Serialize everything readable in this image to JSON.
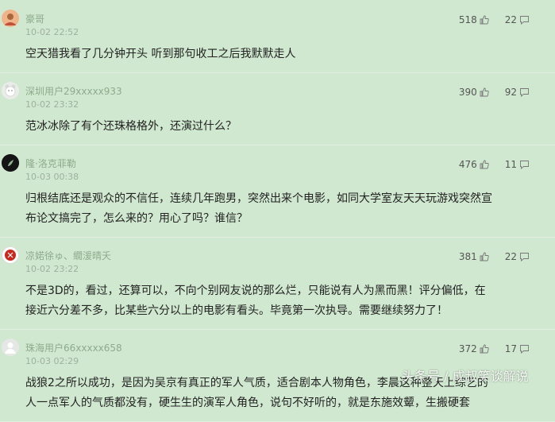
{
  "comments": [
    {
      "username": "豪哥",
      "time": "10-02 22:52",
      "likes": "518",
      "replies": "22",
      "text": "空天猎我看了几分钟开头 听到那句收工之后我默默走人"
    },
    {
      "username": "深圳用户29xxxxx933",
      "time": "10-02 23:32",
      "likes": "390",
      "replies": "92",
      "text": "范冰冰除了有个还珠格格外，还演过什么？"
    },
    {
      "username": "隆·洛克菲勒",
      "time": "10-03 00:38",
      "likes": "476",
      "replies": "11",
      "text": "归根结底还是观众的不信任，连续几年跑男，突然出来个电影，如同大学室友天天玩游戏突然宣\n布论文搞完了，怎么来的？用心了吗？谁信？"
    },
    {
      "username": "凉婼徐ゅ、繝湲晴夭",
      "time": "10-02 23:22",
      "likes": "381",
      "replies": "22",
      "text": "不是3D的，看过，还算可以，不向个别网友说的那么烂，只能说有人为黑而黑！评分偏低，在\n接近六分差不多，比某些六分以上的电影有看头。毕竟第一次执导。需要继续努力了！"
    },
    {
      "username": "珠海用户66xxxxx658",
      "time": "10-03 02:29",
      "likes": "372",
      "replies": "17",
      "text": "战狼2之所以成功，是因为吴京有真正的军人气质，适合剧本人物角色，李晨这种整天上综艺的\n人一点军人的气质都没有，硬生生的演军人角色，说句不好听的，就是东施效颦，生搬硬套"
    }
  ],
  "watermark": "头条号 / 成叔笑谈解说"
}
